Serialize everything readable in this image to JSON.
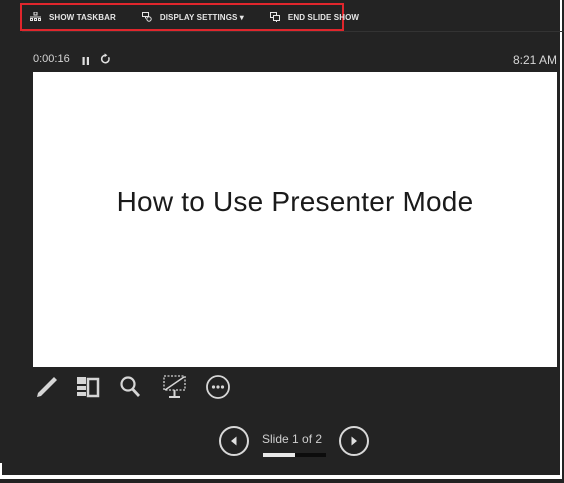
{
  "toolbar": {
    "show_taskbar": "SHOW TASKBAR",
    "display_settings": "DISPLAY SETTINGS ▾",
    "end_slide_show": "END SLIDE SHOW",
    "highlight_color": "#e0262c"
  },
  "timer": {
    "elapsed": "0:00:16",
    "clock": "8:21 AM"
  },
  "slide": {
    "title": "How to Use Presenter Mode"
  },
  "tools": [
    "pen-icon",
    "see-all-slides-icon",
    "zoom-icon",
    "black-screen-icon",
    "more-options-icon"
  ],
  "navigation": {
    "counter": "Slide 1 of 2",
    "current": 1,
    "total": 2,
    "progress_fraction": 0.5
  }
}
